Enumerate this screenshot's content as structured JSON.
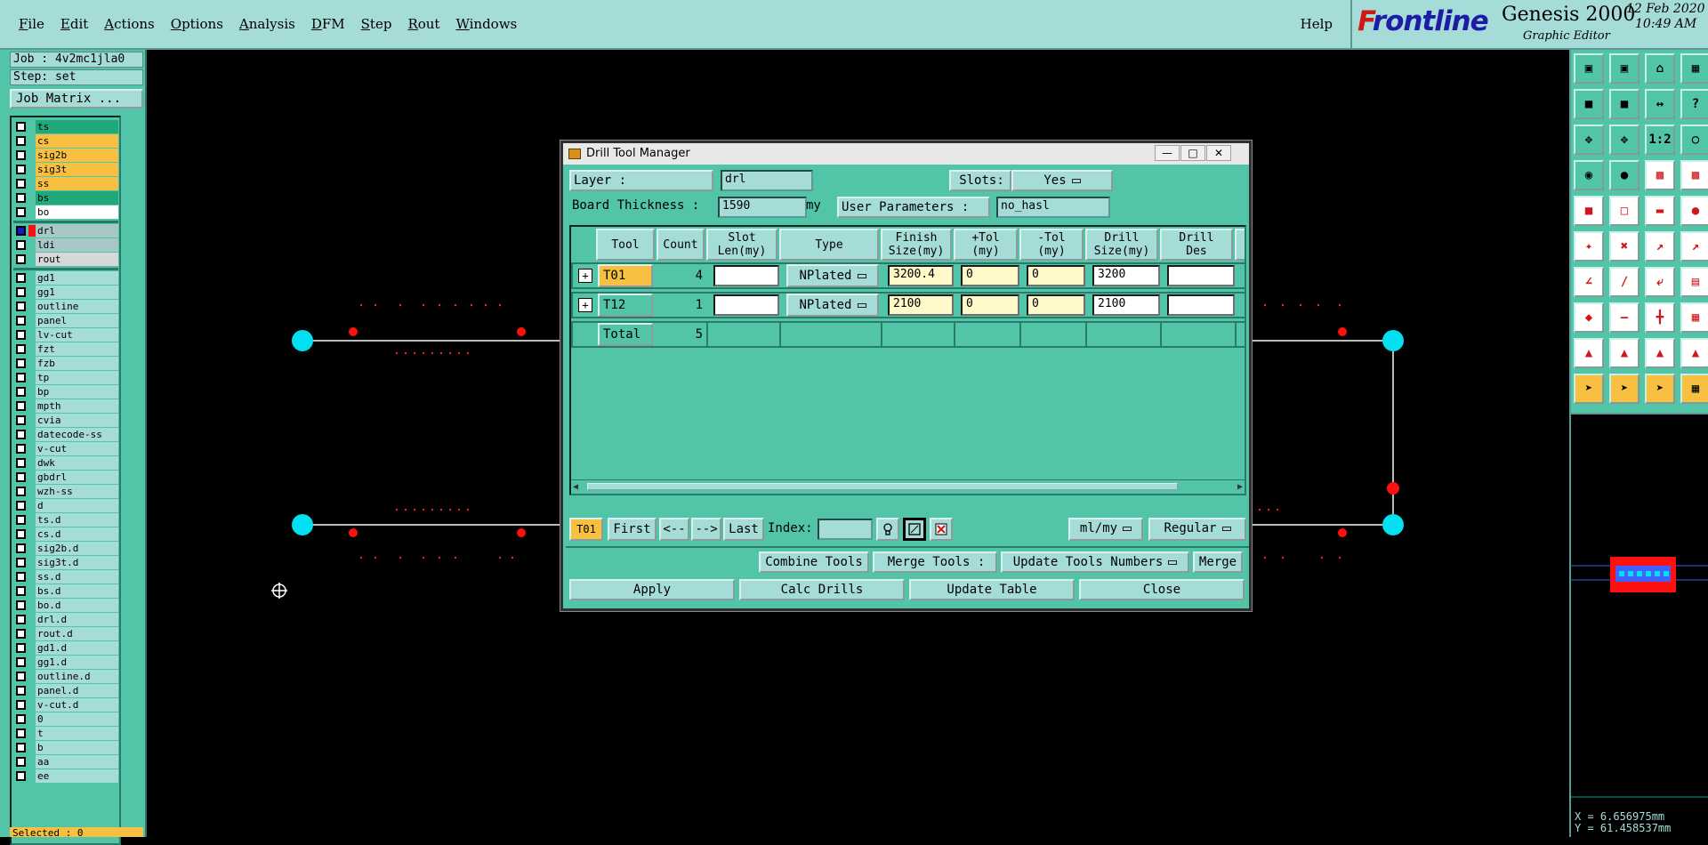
{
  "menu": {
    "items": [
      {
        "label": "File",
        "u": "F",
        "rest": "ile"
      },
      {
        "label": "Edit",
        "u": "E",
        "rest": "dit"
      },
      {
        "label": "Actions",
        "u": "A",
        "rest": "ctions"
      },
      {
        "label": "Options",
        "u": "O",
        "rest": "ptions"
      },
      {
        "label": "Analysis",
        "u": "A",
        "rest": "nalysis"
      },
      {
        "label": "DFM",
        "u": "D",
        "rest": "FM"
      },
      {
        "label": "Step",
        "u": "S",
        "rest": "tep"
      },
      {
        "label": "Rout",
        "u": "R",
        "rest": "out"
      },
      {
        "label": "Windows",
        "u": "W",
        "rest": "indows"
      }
    ],
    "help": "Help"
  },
  "brand": {
    "logo_f": "F",
    "logo_rest": "rontline",
    "product": "Genesis 2000",
    "subtitle": "Graphic Editor",
    "date": "12 Feb 2020",
    "time": "10:49 AM"
  },
  "left": {
    "job": "Job : 4v2mc1jla0",
    "step": "Step: set",
    "job_matrix": "Job Matrix ...",
    "selected": "Selected : 0"
  },
  "layers_group1": [
    {
      "name": "ts",
      "color": "#20a878"
    },
    {
      "name": "cs",
      "color": "#f8c040"
    },
    {
      "name": "sig2b",
      "color": "#f8c040"
    },
    {
      "name": "sig3t",
      "color": "#f8c040"
    },
    {
      "name": "ss",
      "color": "#f8c040"
    },
    {
      "name": "bs",
      "color": "#20a878"
    },
    {
      "name": "bo",
      "color": "#ffffff"
    }
  ],
  "layers_group2": [
    {
      "name": "drl",
      "color": "#a8c8c8"
    },
    {
      "name": "ldi",
      "color": "#a8c8c8"
    },
    {
      "name": "rout",
      "color": "#d8d8d8"
    }
  ],
  "layers_group3": [
    {
      "name": "gd1"
    },
    {
      "name": "gg1"
    },
    {
      "name": "outline"
    },
    {
      "name": "panel"
    },
    {
      "name": "lv-cut"
    },
    {
      "name": "fzt"
    },
    {
      "name": "fzb"
    },
    {
      "name": "tp"
    },
    {
      "name": "bp"
    },
    {
      "name": "mpth"
    },
    {
      "name": "cvia"
    },
    {
      "name": "datecode-ss"
    },
    {
      "name": "v-cut"
    },
    {
      "name": "dwk"
    },
    {
      "name": "gbdrl"
    },
    {
      "name": "wzh-ss"
    },
    {
      "name": "d"
    },
    {
      "name": "ts.d"
    },
    {
      "name": "cs.d"
    },
    {
      "name": "sig2b.d"
    },
    {
      "name": "sig3t.d"
    },
    {
      "name": "ss.d"
    },
    {
      "name": "bs.d"
    },
    {
      "name": "bo.d"
    },
    {
      "name": "drl.d"
    },
    {
      "name": "rout.d"
    },
    {
      "name": "gd1.d"
    },
    {
      "name": "gg1.d"
    },
    {
      "name": "outline.d"
    },
    {
      "name": "panel.d"
    },
    {
      "name": "v-cut.d"
    },
    {
      "name": "0"
    },
    {
      "name": "t"
    },
    {
      "name": "b"
    },
    {
      "name": "aa"
    },
    {
      "name": "ee"
    }
  ],
  "coords": {
    "x": "X = 6.656975mm",
    "y": "Y = 61.458537mm"
  },
  "dialog": {
    "title": "Drill Tool Manager",
    "layer_label": "Layer          :",
    "layer_value": "drl",
    "slots_label": "Slots:",
    "slots_value": "Yes",
    "board_thickness_label": "Board Thickness :",
    "board_thickness_value": "1590",
    "board_thickness_unit": "my",
    "user_params_label": "User Parameters :",
    "user_params_value": "no_hasl",
    "headers": {
      "tool": "Tool",
      "count": "Count",
      "slot_len_1": "Slot",
      "slot_len_2": "Len(my)",
      "type": "Type",
      "finish_1": "Finish",
      "finish_2": "Size(my)",
      "ptol_1": "+Tol",
      "ptol_2": "(my)",
      "ntol_1": "-Tol",
      "ntol_2": "(my)",
      "drill_1": "Drill",
      "drill_2": "Size(my)",
      "des_1": "Drill",
      "des_2": "Des"
    },
    "rows": [
      {
        "tool": "T01",
        "count": "4",
        "slot_len": "",
        "type": "NPlated",
        "finish": "3200.4",
        "ptol": "0",
        "ntol": "0",
        "drill": "3200",
        "des": ""
      },
      {
        "tool": "T12",
        "count": "1",
        "slot_len": "",
        "type": "NPlated",
        "finish": "2100",
        "ptol": "0",
        "ntol": "0",
        "drill": "2100",
        "des": ""
      }
    ],
    "total_label": "Total",
    "total_count": "5",
    "current_tool": "T01",
    "nav": {
      "first": "First",
      "prev": "<--",
      "next": "-->",
      "last": "Last",
      "index_label": "Index:"
    },
    "units": "ml/my",
    "mode": "Regular",
    "combine": "Combine Tools",
    "merge_label": "Merge Tools :",
    "merge_option": "Update Tools Numbers",
    "merge_btn": "Merge",
    "apply": "Apply",
    "calc": "Calc Drills",
    "update_table": "Update Table",
    "close": "Close"
  }
}
